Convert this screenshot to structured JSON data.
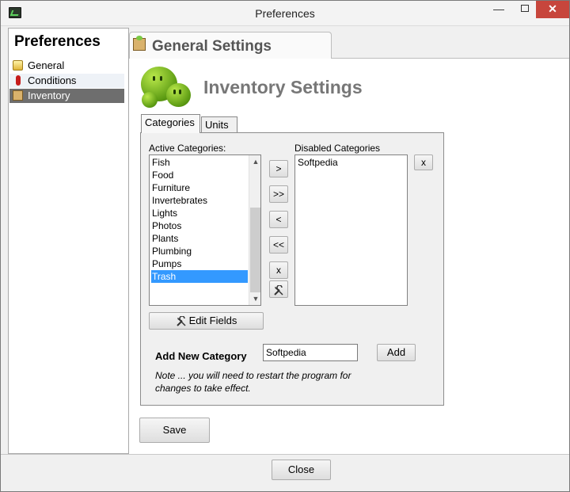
{
  "window": {
    "title": "Preferences",
    "minimize": "—",
    "close": "✕"
  },
  "sidebar": {
    "title": "Preferences",
    "items": [
      {
        "label": "General",
        "icon": "folder-icon"
      },
      {
        "label": "Conditions",
        "icon": "thermometer-icon"
      },
      {
        "label": "Inventory",
        "icon": "box-icon",
        "selected": true
      }
    ]
  },
  "main": {
    "tab_label": "General Settings",
    "section_title": "Inventory Settings",
    "subtabs": [
      {
        "label": "Categories",
        "active": true
      },
      {
        "label": "Units"
      }
    ],
    "active_label": "Active Categories:",
    "disabled_label": "Disabled Categories",
    "active_categories": [
      "Fish",
      "Food",
      "Furniture",
      "Invertebrates",
      "Lights",
      "Photos",
      "Plants",
      "Plumbing",
      "Pumps",
      "Trash"
    ],
    "selected_active": "Trash",
    "disabled_categories": [
      "Softpedia"
    ],
    "move_buttons": [
      ">",
      ">>",
      "<",
      "<<",
      "x"
    ],
    "remove_disabled_button": "x",
    "edit_fields_button": "Edit Fields",
    "add_new_label": "Add New Category",
    "add_input_value": "Softpedia",
    "add_button": "Add",
    "note_line1": "Note ... you will need to restart the program for",
    "note_line2": "changes to take effect.",
    "save_button": "Save"
  },
  "footer": {
    "close_button": "Close"
  },
  "colors": {
    "selection": "#3399ff",
    "selected_nav": "#6e6e6e",
    "blob_green": "#6aa81a"
  }
}
